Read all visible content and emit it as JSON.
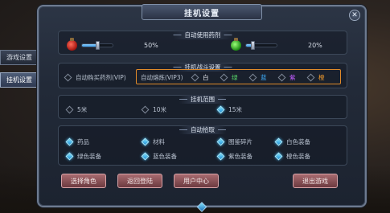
{
  "window": {
    "title": "挂机设置",
    "close_glyph": "✕"
  },
  "side_tabs": [
    {
      "label": "游戏设置",
      "active": false
    },
    {
      "label": "挂机设置",
      "active": true
    }
  ],
  "potions": {
    "title": "自动使用药剂",
    "hp": {
      "value_text": "50%",
      "value": 50,
      "icon": "red-potion-icon"
    },
    "mp": {
      "value_text": "20%",
      "value": 20,
      "icon": "green-potion-icon"
    }
  },
  "combat": {
    "title": "挂机战斗设置",
    "auto_buy": {
      "label": "自动购买药剂(VIP)",
      "checked": false
    },
    "auto_smelt": {
      "label": "自动熔炼(VIP3)"
    },
    "qualities": [
      {
        "label": "白",
        "checked": false,
        "color": "#e6e9ee"
      },
      {
        "label": "绿",
        "checked": false,
        "color": "#58d96a"
      },
      {
        "label": "蓝",
        "checked": false,
        "color": "#3fb0ff"
      },
      {
        "label": "紫",
        "checked": false,
        "color": "#c05cff"
      },
      {
        "label": "橙",
        "checked": false,
        "color": "#f09a2e"
      }
    ],
    "highlight_color": "#e08a2a"
  },
  "range": {
    "title": "挂机范围",
    "options": [
      {
        "label": "5米",
        "checked": false
      },
      {
        "label": "10米",
        "checked": false
      },
      {
        "label": "15米",
        "checked": true
      }
    ]
  },
  "pickup": {
    "title": "自动拾取",
    "items": [
      {
        "label": "药品",
        "checked": true
      },
      {
        "label": "材料",
        "checked": true
      },
      {
        "label": "图鉴碎片",
        "checked": true
      },
      {
        "label": "白色装备",
        "checked": true
      },
      {
        "label": "绿色装备",
        "checked": true
      },
      {
        "label": "蓝色装备",
        "checked": true
      },
      {
        "label": "紫色装备",
        "checked": true
      },
      {
        "label": "橙色装备",
        "checked": true
      }
    ]
  },
  "buttons": {
    "choose_role": "选择角色",
    "return_login": "返回登陆",
    "user_center": "用户中心",
    "exit_game": "退出游戏"
  },
  "colors": {
    "accent": "#3fb0ff",
    "button": "#8a4d53"
  }
}
